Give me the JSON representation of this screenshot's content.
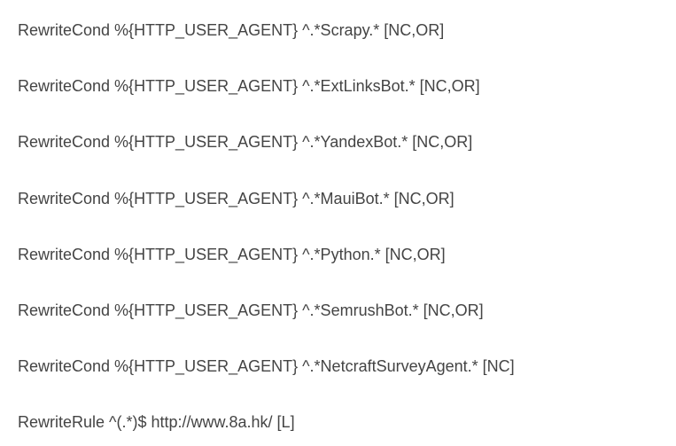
{
  "lines": [
    "RewriteCond %{HTTP_USER_AGENT} ^.*Scrapy.* [NC,OR]",
    "RewriteCond %{HTTP_USER_AGENT} ^.*ExtLinksBot.* [NC,OR]",
    "RewriteCond %{HTTP_USER_AGENT} ^.*YandexBot.* [NC,OR]",
    "RewriteCond %{HTTP_USER_AGENT} ^.*MauiBot.* [NC,OR]",
    "RewriteCond %{HTTP_USER_AGENT} ^.*Python.* [NC,OR]",
    "RewriteCond %{HTTP_USER_AGENT} ^.*SemrushBot.* [NC,OR]",
    "RewriteCond %{HTTP_USER_AGENT} ^.*NetcraftSurveyAgent.* [NC]",
    "RewriteRule ^(.*)$ http://www.8a.hk/ [L]"
  ]
}
